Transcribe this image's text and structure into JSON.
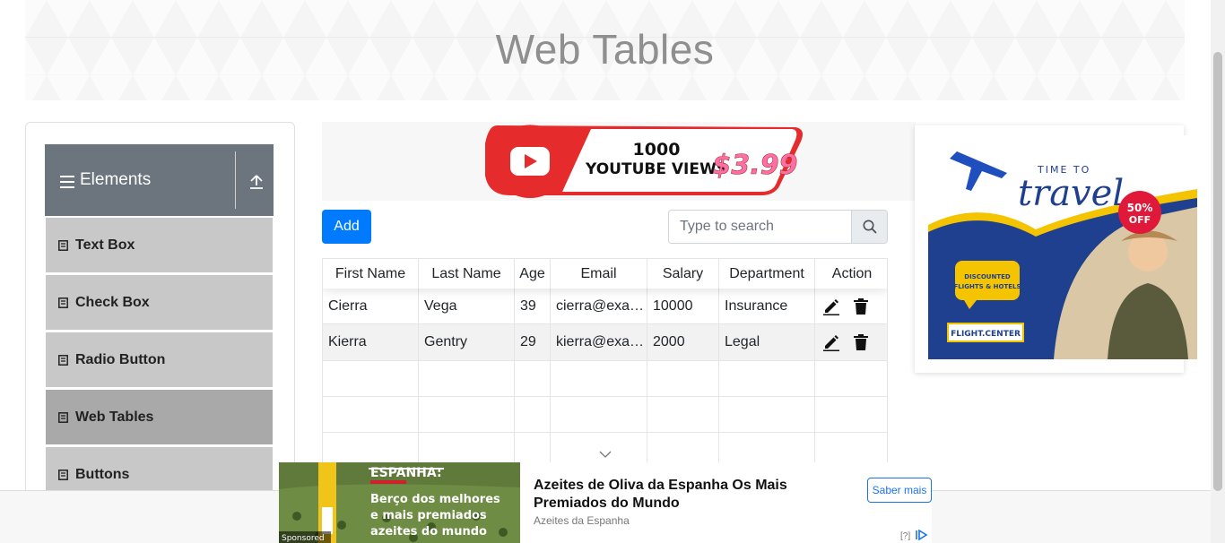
{
  "page": {
    "title": "Web Tables"
  },
  "sidebar": {
    "group_title": "Elements",
    "items": [
      {
        "label": "Text Box"
      },
      {
        "label": "Check Box"
      },
      {
        "label": "Radio Button"
      },
      {
        "label": "Web Tables",
        "active": true
      },
      {
        "label": "Buttons"
      }
    ]
  },
  "top_ad": {
    "line1": "1000",
    "line2": "YOUTUBE VIEWS",
    "price": "$3.99"
  },
  "toolbar": {
    "add_label": "Add",
    "search_placeholder": "Type to search"
  },
  "table": {
    "columns": [
      "First Name",
      "Last Name",
      "Age",
      "Email",
      "Salary",
      "Department",
      "Action"
    ],
    "rows": [
      {
        "first": "Cierra",
        "last": "Vega",
        "age": "39",
        "email": "cierra@example.com",
        "salary": "10000",
        "department": "Insurance"
      },
      {
        "first": "Kierra",
        "last": "Gentry",
        "age": "29",
        "email": "kierra@example.com",
        "salary": "2000",
        "department": "Legal"
      }
    ]
  },
  "right_ad": {
    "close": "✕",
    "time_to": "TIME TO",
    "travel": "travel",
    "discount_pct": "50%",
    "discount_off": "OFF",
    "bubble1": "DISCOUNTED",
    "bubble2": "FLIGHTS & HOTELS",
    "brand": "FLIGHT.CENTER"
  },
  "bottom_ad": {
    "image_title": "ESPANHA:",
    "image_line1": "Berço dos melhores",
    "image_line2": "e mais premiados",
    "image_line3": "azeites do mundo",
    "sponsored": "Sponsored",
    "headline": "Azeites de Oliva da Espanha Os Mais Premiados do Mundo",
    "advertiser": "Azeites da Espanha",
    "cta": "Saber mais",
    "info": "[?]"
  },
  "colors": {
    "primary": "#007bff",
    "group_header": "#6c757d",
    "menu_item": "#c8c8c8",
    "menu_active": "#a9a9a9",
    "ad_close": "#00aecd"
  }
}
